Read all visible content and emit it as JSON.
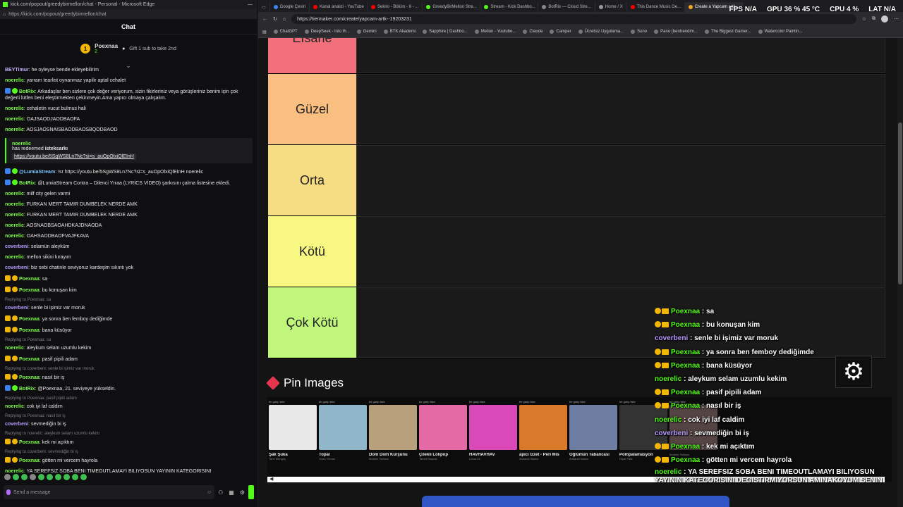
{
  "left_window": {
    "title": "kick.com/popout/greedybirmellon/chat - Personal - Microsoft Edge",
    "url": "https://kick.com/popout/greedybirmellon/chat",
    "chat_header": "Chat",
    "pinned": {
      "name": "Poexnaa",
      "level": "2",
      "gift_text": "Gift 1 sub to take 2nd"
    },
    "redeem": {
      "user": "noerelic",
      "text": "has redeemed",
      "reward": "isteksarkı",
      "link": "https://youtu.be/5SgWS8Ln7Nc?si=s_auOpOlxiQlEInH"
    },
    "messages": [
      {
        "user": "BEYTimur",
        "color": "#c4b0ff",
        "text": "he oyleyse bende ekleyebilirim"
      },
      {
        "user": "noerelic",
        "color": "#7dfc4a",
        "text": "yarram tearlist oynanmaz yapilir aptal cehalet"
      },
      {
        "user": "BotRix",
        "color": "#7dfc4a",
        "badge": "bot",
        "text": "Arkadaşlar ben sizlere çok değer veriyorum, sizin fikirleriniz veya görüşleriniz benim için çok değerli lütfen beni eleştirmekten çekinmeyin.Ama yapıcı olmaya çalışalım."
      },
      {
        "user": "noerelic",
        "color": "#7dfc4a",
        "text": "cehaletin vucut bulmus hali"
      },
      {
        "user": "noerelic",
        "color": "#7dfc4a",
        "text": "OAJSAODJAODBAOFA"
      },
      {
        "user": "noerelic",
        "color": "#7dfc4a",
        "text": "AOSJAOSNAISBAODBAOSBQODBAOD"
      }
    ],
    "messages2": [
      {
        "user": "@LumiaStream",
        "color": "#7dc4ff",
        "badge": "bot",
        "text": "!sr https://youtu.be/5SgWS8Ln7Nc?si=s_auOpOlxiQlEInH noerelic"
      },
      {
        "user": "BotRix",
        "color": "#7dfc4a",
        "badge": "bot",
        "text": "@LumiaStream Contra – Dilenci Yrraa (LYRİCS VİDEO) şarkısını çalma listesine ekledi."
      },
      {
        "user": "noerelic",
        "color": "#7dfc4a",
        "text": "milf city gelen varmi"
      },
      {
        "user": "noerelic",
        "color": "#7dfc4a",
        "text": "FURKAN MERT TAMIR DUMBELEK NERDE AMK"
      },
      {
        "user": "noerelic",
        "color": "#7dfc4a",
        "text": "FURKAN MERT TAMIR DUMBELEK NERDE AMK"
      },
      {
        "user": "noerelic",
        "color": "#7dfc4a",
        "text": "AOSNAOBSAOAHDKAJDNAODA"
      },
      {
        "user": "noerelic",
        "color": "#7dfc4a",
        "text": "OAHSAODBAOFVAJFKAVA"
      },
      {
        "user": "coverbeni",
        "color": "#b79cff",
        "text": "selamün aleyküm"
      },
      {
        "user": "noerelic",
        "color": "#7dfc4a",
        "text": "mellon sikini kırayım"
      },
      {
        "user": "coverbeni",
        "color": "#b79cff",
        "text": "biz sebi chatinle seviyoruz kardeşim sıkıntı yok"
      },
      {
        "user": "Poexnaa",
        "color": "#7dfc4a",
        "badge": "sub",
        "text": "sa"
      },
      {
        "user": "Poexnaa",
        "color": "#7dfc4a",
        "badge": "sub",
        "text": "bu konuşan kim"
      },
      {
        "reply": "Replying to Poexnaa: sa",
        "user": "coverbeni",
        "color": "#b79cff",
        "text": "senle bi işimiz var moruk"
      },
      {
        "user": "Poexnaa",
        "color": "#7dfc4a",
        "badge": "sub",
        "text": "ya sonra ben femboy dediğimde"
      },
      {
        "user": "Poexnaa",
        "color": "#7dfc4a",
        "badge": "sub",
        "text": "bana küsüyor"
      },
      {
        "reply": "Replying to Poexnaa: sa",
        "user": "noerelic",
        "color": "#7dfc4a",
        "text": "aleykum selam uzumlu kekim"
      },
      {
        "user": "Poexnaa",
        "color": "#7dfc4a",
        "badge": "sub",
        "text": "pasif pipili adam"
      },
      {
        "reply": "Replying to coverbeni: senle bi işimiz var moruk",
        "user": "Poexnaa",
        "color": "#7dfc4a",
        "badge": "sub",
        "text": "nasıl bir iş"
      },
      {
        "user": "BotRix",
        "color": "#7dfc4a",
        "badge": "bot",
        "text": "@Poexnaa, 21. seviyeye yükseldin."
      },
      {
        "reply": "Replying to Poexnaa: pasif pipili adam",
        "user": "noerelic",
        "color": "#7dfc4a",
        "text": "cok iyi laf caldim"
      },
      {
        "reply": "Replying to Poexnaa: nasıl bir iş",
        "user": "coverbeni",
        "color": "#b79cff",
        "text": "sevmediğin bi iş"
      },
      {
        "reply": "Replying to noerelic: aleykum selam uzumlu kekim",
        "user": "Poexnaa",
        "color": "#7dfc4a",
        "badge": "sub",
        "text": "kek mi açıktım"
      },
      {
        "reply": "Replying to coverbeni: sevmediğin bi iş",
        "user": "Poexnaa",
        "color": "#7dfc4a",
        "badge": "sub",
        "text": "götten mi vercem hayrola"
      },
      {
        "user": "noerelic",
        "color": "#7dfc4a",
        "text": "YA SEREFSIZ SOBA BENI TIMEOUTLAMAYI BILIYOSUN YAYININ KATEGORISINI DEGISTIRMIYORSUN AMINAKOYUM SENIN"
      }
    ],
    "send_placeholder": "Send a message"
  },
  "browser": {
    "tabs": [
      {
        "label": "Google Çeviri",
        "color": "#4285f4"
      },
      {
        "label": "Kanal analizi - YouTube",
        "color": "#ff0000"
      },
      {
        "label": "Sekiro - Bölüm - 6 - ...",
        "color": "#ff0000"
      },
      {
        "label": "GreedyBirMellon Stre...",
        "color": "#53fc18"
      },
      {
        "label": "Stream - Kick Dashbo...",
        "color": "#53fc18"
      },
      {
        "label": "BotRix — Cloud Stre...",
        "color": "#888"
      },
      {
        "label": "Home / X",
        "color": "#999"
      },
      {
        "label": "This Dance Music Ge...",
        "color": "#ff0000"
      },
      {
        "label": "Create a Yapcam artk...",
        "color": "#f5a623",
        "active": true
      }
    ],
    "url": "https://tiermaker.com/create/yapcam-artk--19203231",
    "bookmarks": [
      "ChatGPT",
      "DeepSeek - Into th...",
      "Gemini",
      "BTK Akademi",
      "Sapphire | Dashbo...",
      "Mellon - Youtube...",
      "Claude",
      "Camper",
      "Ücretsiz Uygulama...",
      "Suno",
      "Pano (bentrendim...",
      "The Biggest Gamer...",
      "Watercolor Paintin..."
    ]
  },
  "stats": {
    "fps_label": "FPS",
    "fps": "N/A",
    "gpu_label": "GPU",
    "gpu": "36 % 45 °C",
    "cpu_label": "CPU",
    "cpu": "4 %",
    "lat_label": "LAT",
    "lat": "N/A"
  },
  "tiers": [
    {
      "label": "Efsane",
      "color": "#f2707c"
    },
    {
      "label": "Güzel",
      "color": "#f8bf81"
    },
    {
      "label": "Orta",
      "color": "#f6dd83"
    },
    {
      "label": "Kötü",
      "color": "#f8f782"
    },
    {
      "label": "Çok Kötü",
      "color": "#c0f77b"
    }
  ],
  "pin_images": {
    "title": "Pin Images",
    "cards": [
      {
        "title": "Şak Şuka",
        "artist": "Tarık Mengüç",
        "color": "#e8e8e8"
      },
      {
        "title": "Topal",
        "artist": "Ozan Yılmaz",
        "color": "#8fb7c9"
      },
      {
        "title": "Dom Dom Kurşunu",
        "artist": "İbrahim Tatlıses",
        "color": "#b7a07a"
      },
      {
        "title": "Çilekli Lolipop",
        "artist": "Tamer Boşnak",
        "color": "#e46aa6"
      },
      {
        "title": "HAVHAVHAV",
        "artist": "Lokal Cli",
        "color": "#d94ab8"
      },
      {
        "title": "apıcı İzzet - Peri Mis",
        "artist": "Ankaralı Namık",
        "color": "#d87a2a"
      },
      {
        "title": "Oğlumun Tabancası",
        "artist": "Ankaralı Namık",
        "color": "#6e7ea3"
      },
      {
        "title": "Pompalamasyon",
        "artist": "Diyar Pala",
        "color": "#333"
      },
      {
        "title": "",
        "artist": "İbrahim Tatlıses",
        "color": "#544"
      }
    ],
    "playlist_label": "bir garip liste"
  },
  "overlay_chat": [
    {
      "user": "Poexnaa",
      "color": "#53fc18",
      "badge": true,
      "text": ": sa"
    },
    {
      "user": "Poexnaa",
      "color": "#53fc18",
      "badge": true,
      "text": ": bu konuşan kim"
    },
    {
      "user": "coverbeni",
      "color": "#b79cff",
      "text": ": senle bi işimiz var moruk"
    },
    {
      "user": "Poexnaa",
      "color": "#53fc18",
      "badge": true,
      "text": ": ya sonra ben femboy dediğimde"
    },
    {
      "user": "Poexnaa",
      "color": "#53fc18",
      "badge": true,
      "text": ": bana küsüyor"
    },
    {
      "user": "noerelic",
      "color": "#53fc18",
      "text": ": aleykum selam uzumlu kekim"
    },
    {
      "user": "Poexnaa",
      "color": "#53fc18",
      "badge": true,
      "text": ": pasif pipili adam"
    },
    {
      "user": "Poexnaa",
      "color": "#53fc18",
      "badge": true,
      "text": ": nasıl bir iş"
    },
    {
      "user": "noerelic",
      "color": "#53fc18",
      "text": ": cok iyi laf caldim"
    },
    {
      "user": "coverbeni",
      "color": "#b79cff",
      "text": ": sevmediğin bi iş"
    },
    {
      "user": "Poexnaa",
      "color": "#53fc18",
      "badge": true,
      "text": ": kek mi açıktım"
    },
    {
      "user": "Poexnaa",
      "color": "#53fc18",
      "badge": true,
      "text": ": götten mi vercem hayrola"
    },
    {
      "user": "noerelic",
      "color": "#53fc18",
      "text": ": YA SEREFSIZ SOBA BENI TIMEOUTLAMAYI BILIYOSUN YAYININ KATEGORISINI DEGISTIRMIYORSUN AMINAKOYUM SENIN",
      "multi": true
    }
  ]
}
